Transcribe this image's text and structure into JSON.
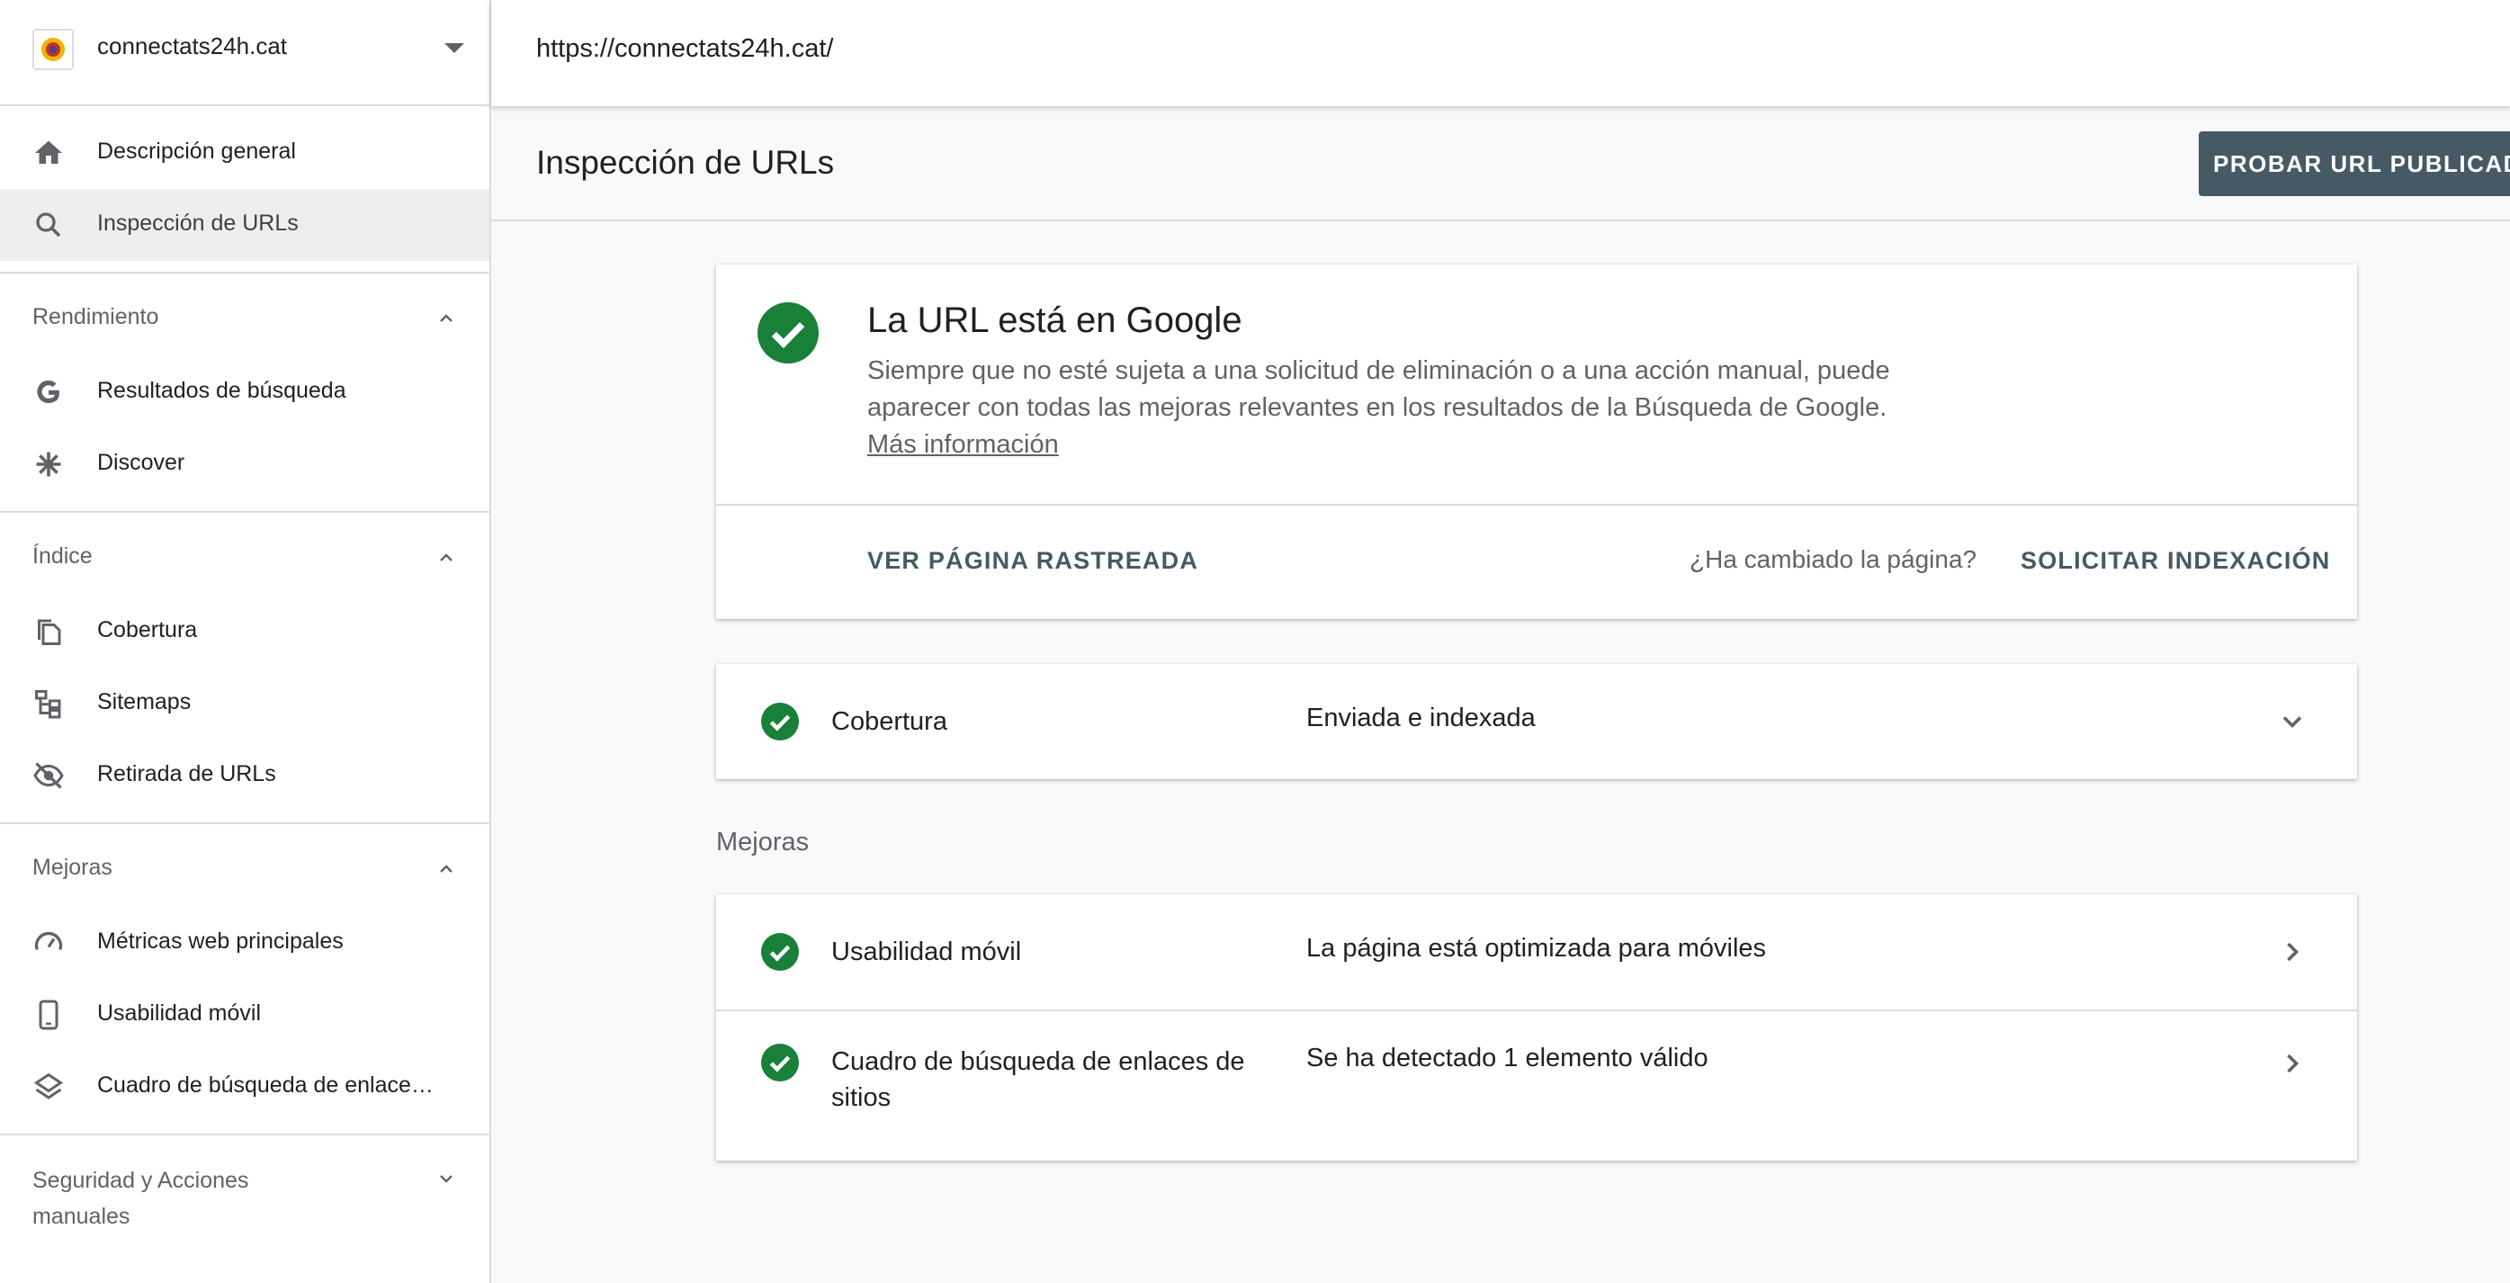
{
  "property": {
    "name": "connectats24h.cat"
  },
  "topbar": {
    "url": "https://connectats24h.cat/"
  },
  "nav": {
    "overview": "Descripción general",
    "inspection": "Inspección de URLs",
    "sections": [
      {
        "title": "Rendimiento",
        "items": [
          "Resultados de búsqueda",
          "Discover"
        ]
      },
      {
        "title": "Índice",
        "items": [
          "Cobertura",
          "Sitemaps",
          "Retirada de URLs"
        ]
      },
      {
        "title": "Mejoras",
        "items": [
          "Métricas web principales",
          "Usabilidad móvil",
          "Cuadro de búsqueda de enlace…"
        ]
      }
    ],
    "security": "Seguridad y Acciones manuales"
  },
  "page": {
    "title": "Inspección de URLs",
    "test_button": "PROBAR URL PUBLICADA"
  },
  "status": {
    "title": "La URL está en Google",
    "description": "Siempre que no esté sujeta a una solicitud de eliminación o a una acción manual, puede aparecer con todas las mejoras relevantes en los resultados de la Búsqueda de Google.",
    "more_link": "Más información",
    "view_crawled": "VER PÁGINA RASTREADA",
    "changed_question": "¿Ha cambiado la página?",
    "request_indexing": "SOLICITAR INDEXACIÓN"
  },
  "coverage": {
    "label": "Cobertura",
    "value": "Enviada e indexada"
  },
  "improvements": {
    "section_label": "Mejoras",
    "rows": [
      {
        "label": "Usabilidad móvil",
        "value": "La página está optimizada para móviles"
      },
      {
        "label": "Cuadro de búsqueda de enlaces de sitios",
        "value": "Se ha detectado 1 elemento válido"
      }
    ]
  },
  "colors": {
    "success": "#188038",
    "accent": "#455a64"
  }
}
